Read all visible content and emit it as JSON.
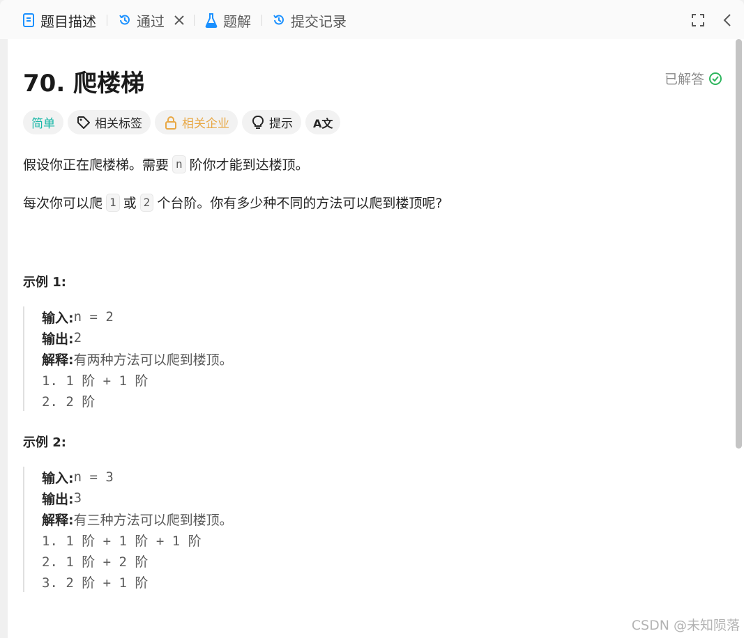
{
  "tabs": [
    {
      "label": "题目描述",
      "icon": "document-icon"
    },
    {
      "label": "通过",
      "icon": "history-icon"
    },
    {
      "label": "题解",
      "icon": "flask-icon"
    },
    {
      "label": "提交记录",
      "icon": "history-icon"
    }
  ],
  "problem": {
    "title": "70. 爬楼梯",
    "status": "已解答"
  },
  "tags": {
    "difficulty": "简单",
    "related_tags": "相关标签",
    "related_companies": "相关企业",
    "hint": "提示",
    "translate": "A文"
  },
  "description": {
    "p1_before": "假设你正在爬楼梯。需要",
    "p1_code": "n",
    "p1_after": "阶你才能到达楼顶。",
    "p2_before": "每次你可以爬",
    "p2_code1": "1",
    "p2_mid": "或",
    "p2_code2": "2",
    "p2_after": "个台阶。你有多少种不同的方法可以爬到楼顶呢?"
  },
  "examples": [
    {
      "heading": "示例 1:",
      "input_label": "输入:",
      "input": "n = 2",
      "output_label": "输出:",
      "output": "2",
      "explain_label": "解释:",
      "explain": "有两种方法可以爬到楼顶。",
      "steps": [
        "1. 1 阶 + 1 阶",
        "2. 2 阶"
      ]
    },
    {
      "heading": "示例 2:",
      "input_label": "输入:",
      "input": "n = 3",
      "output_label": "输出:",
      "output": "3",
      "explain_label": "解释:",
      "explain": "有三种方法可以爬到楼顶。",
      "steps": [
        "1. 1 阶 + 1 阶 + 1 阶",
        "2. 1 阶 + 2 阶",
        "3. 2 阶 + 1 阶"
      ]
    }
  ],
  "watermark": "CSDN @未知陨落",
  "colors": {
    "easy": "#1cb8a8",
    "company": "#e8a845",
    "solved_check": "#2db55d",
    "tab_icon_blue": "#1a90ff"
  }
}
